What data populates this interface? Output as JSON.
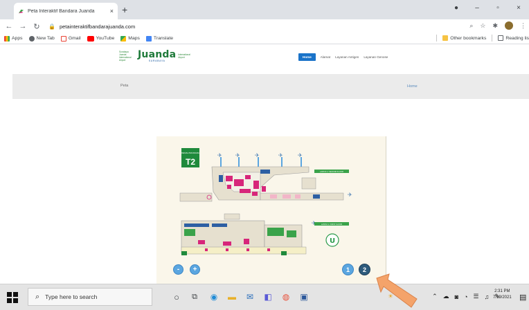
{
  "browser": {
    "tab_title": "Peta Interaktif Bandara Juanda",
    "tab_close": "×",
    "new_tab": "+",
    "url": "petainteraktifbandarajuanda.com",
    "window_controls": [
      "–",
      "▫",
      "×"
    ],
    "toolbar_icons": [
      "search-icon",
      "star-icon",
      "extensions-icon",
      "profile-icon",
      "menu-icon"
    ]
  },
  "bookmarks": {
    "items": [
      {
        "label": "Apps",
        "icon": "apps-grid-icon",
        "color": "#e94235"
      },
      {
        "label": "New Tab",
        "icon": "globe-icon",
        "color": "#5f6368"
      },
      {
        "label": "Gmail",
        "icon": "gmail-icon",
        "color": "#ea4335"
      },
      {
        "label": "YouTube",
        "icon": "youtube-icon",
        "color": "#ff0000"
      },
      {
        "label": "Maps",
        "icon": "maps-icon",
        "color": "#34a853"
      },
      {
        "label": "Translate",
        "icon": "translate-icon",
        "color": "#4285f4"
      }
    ],
    "other": "Other bookmarks",
    "reading": "Reading lis"
  },
  "site": {
    "logo_left": "Surabaya Juanda International Airport",
    "logo_word": "Juanda",
    "logo_city": "SURABAYA",
    "logo_right": "International Airport",
    "nav": [
      "Home",
      "Alamat",
      "Layanan Antigen",
      "Layanan Genose"
    ],
    "crumb_title": "Peta",
    "crumb_link": "Home"
  },
  "map": {
    "terminal_badge_top": "DENAH BANDARA",
    "terminal_badge": "T2",
    "floor2_label": "LANTAI 2 / SECOND FLOOR",
    "floor1_label": "LANTAI 1 / FIRST FLOOR",
    "zoom_out": "-",
    "zoom_in": "+",
    "floor_buttons": [
      "1",
      "2"
    ],
    "active_floor": "2"
  },
  "taskbar": {
    "search_placeholder": "Type here to search",
    "weather_temp": "34",
    "time": "2:31 PM",
    "date": "7/19/2021"
  },
  "colors": {
    "accent_nav": "#1a73c9",
    "map_green": "#3aa34a",
    "map_magenta": "#d7267a",
    "arrow": "#f4a36a"
  }
}
